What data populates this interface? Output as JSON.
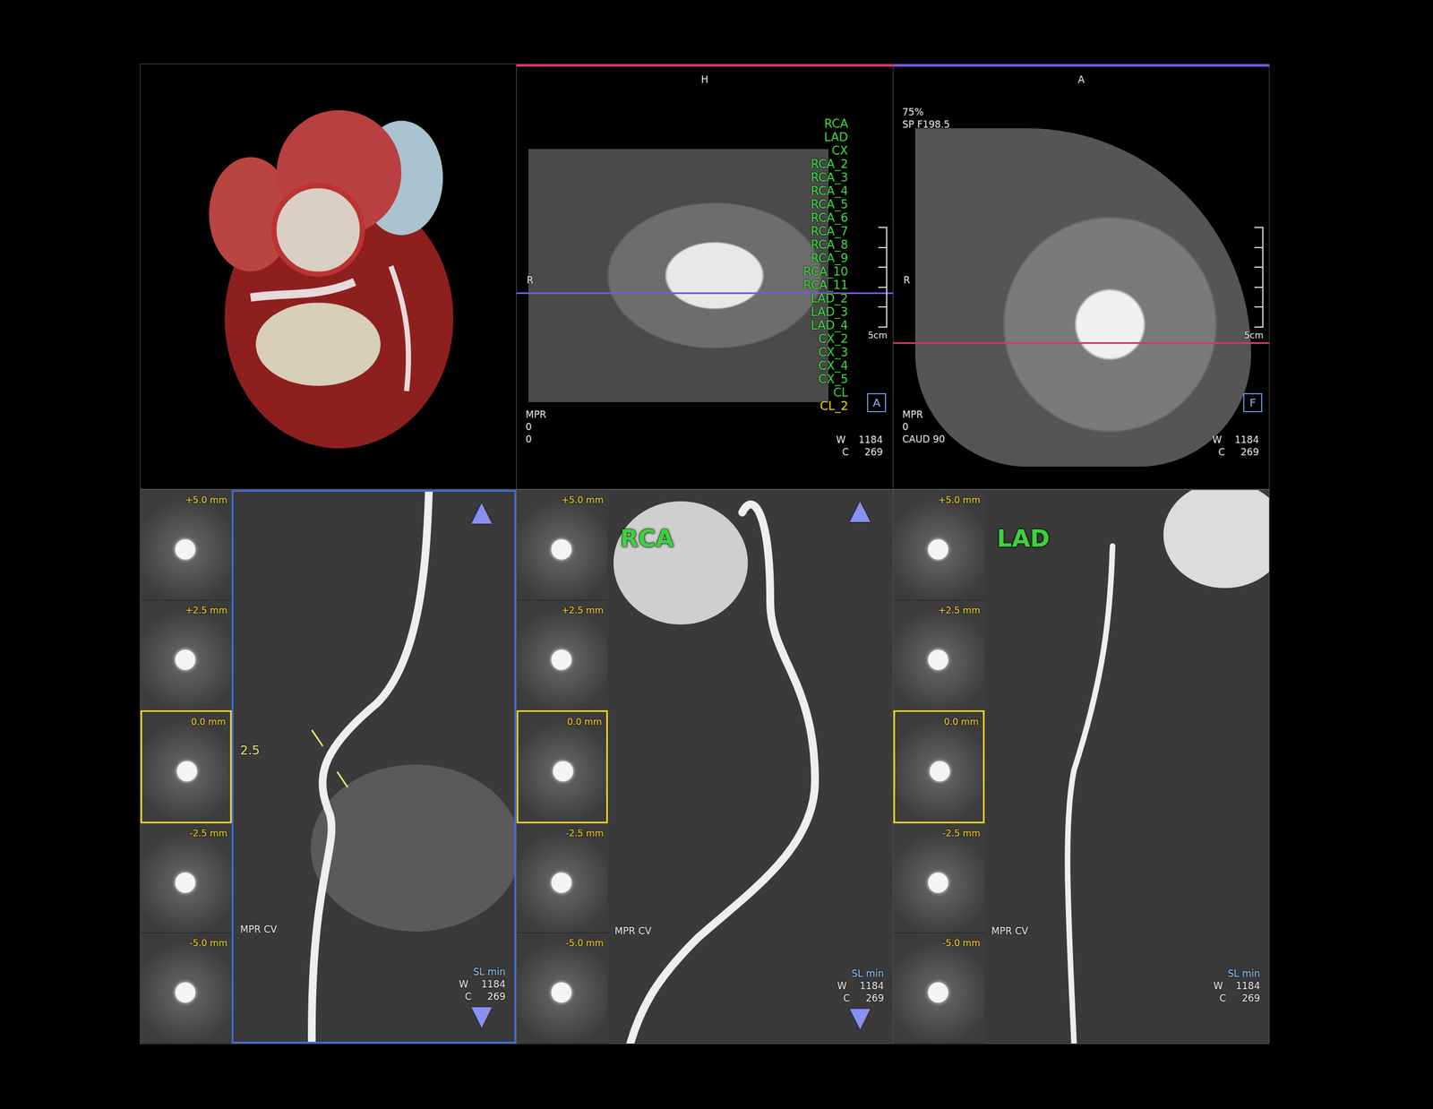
{
  "top_views": [
    {
      "header": "H",
      "color": "#d8336e",
      "orientation": "R",
      "preset_lines": [],
      "mode": "MPR",
      "info": [
        "0",
        "0"
      ],
      "window": {
        "w_label": "W",
        "w": "1184",
        "c_label": "C",
        "c": "269"
      },
      "scale": "5cm",
      "marker": "A",
      "vessels": [
        {
          "name": "RCA",
          "selected": false
        },
        {
          "name": "LAD",
          "selected": false
        },
        {
          "name": "CX",
          "selected": false
        },
        {
          "name": "RCA_2",
          "selected": false
        },
        {
          "name": "RCA_3",
          "selected": false
        },
        {
          "name": "RCA_4",
          "selected": false
        },
        {
          "name": "RCA_5",
          "selected": false
        },
        {
          "name": "RCA_6",
          "selected": false
        },
        {
          "name": "RCA_7",
          "selected": false
        },
        {
          "name": "RCA_8",
          "selected": false
        },
        {
          "name": "RCA_9",
          "selected": false
        },
        {
          "name": "RCA_10",
          "selected": false
        },
        {
          "name": "RCA_11",
          "selected": false
        },
        {
          "name": "LAD_2",
          "selected": false
        },
        {
          "name": "LAD_3",
          "selected": false
        },
        {
          "name": "LAD_4",
          "selected": false
        },
        {
          "name": "CX_2",
          "selected": false
        },
        {
          "name": "CX_3",
          "selected": false
        },
        {
          "name": "CX_4",
          "selected": false
        },
        {
          "name": "CX_5",
          "selected": false
        },
        {
          "name": "CL",
          "selected": false
        },
        {
          "name": "CL_2",
          "selected": true
        }
      ]
    },
    {
      "header": "A",
      "color": "#7a55e8",
      "orientation": "R",
      "preset_lines": [
        "75%",
        "SP F198.5"
      ],
      "mode": "MPR",
      "info": [
        "0",
        "CAUD 90"
      ],
      "window": {
        "w_label": "W",
        "w": "1184",
        "c_label": "C",
        "c": "269"
      },
      "scale": "5cm",
      "marker": "F",
      "vessels": []
    }
  ],
  "curved_views": [
    {
      "title": null,
      "selected": true,
      "arrows": [
        "▲",
        "▼"
      ],
      "measurement": "2.5",
      "mode": "MPR CV",
      "slab": "SL min",
      "window": {
        "w_label": "W",
        "w": "1184",
        "c_label": "C",
        "c": "269"
      },
      "thumbnails": [
        {
          "offset": "+5.0 mm",
          "selected": false
        },
        {
          "offset": "+2.5 mm",
          "selected": false
        },
        {
          "offset": "0.0 mm",
          "selected": true
        },
        {
          "offset": "-2.5 mm",
          "selected": false
        },
        {
          "offset": "-5.0 mm",
          "selected": false
        }
      ]
    },
    {
      "title": "RCA",
      "selected": false,
      "arrows": [
        "▲",
        "▼"
      ],
      "measurement": null,
      "mode": "MPR CV",
      "slab": "SL min",
      "window": {
        "w_label": "W",
        "w": "1184",
        "c_label": "C",
        "c": "269"
      },
      "thumbnails": [
        {
          "offset": "+5.0 mm",
          "selected": false
        },
        {
          "offset": "+2.5 mm",
          "selected": false
        },
        {
          "offset": "0.0 mm",
          "selected": true
        },
        {
          "offset": "-2.5 mm",
          "selected": false
        },
        {
          "offset": "-5.0 mm",
          "selected": false
        }
      ]
    },
    {
      "title": "LAD",
      "selected": false,
      "arrows": [],
      "measurement": null,
      "mode": "MPR CV",
      "slab": "SL min",
      "window": {
        "w_label": "W",
        "w": "1184",
        "c_label": "C",
        "c": "269"
      },
      "thumbnails": [
        {
          "offset": "+5.0 mm",
          "selected": false
        },
        {
          "offset": "+2.5 mm",
          "selected": false
        },
        {
          "offset": "0.0 mm",
          "selected": true
        },
        {
          "offset": "-2.5 mm",
          "selected": false
        },
        {
          "offset": "-5.0 mm",
          "selected": false
        }
      ]
    }
  ]
}
